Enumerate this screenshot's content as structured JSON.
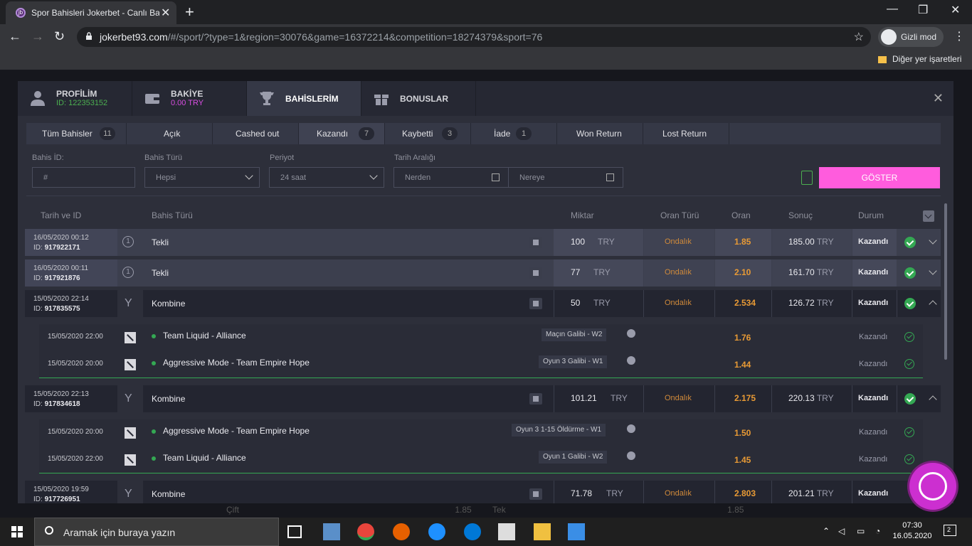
{
  "browser": {
    "tab_title": "Spor Bahisleri Jokerbet - Canlı Ba",
    "tab_favicon": "jb",
    "url_domain": "jokerbet93.com",
    "url_path": "/#/sport/?type=1&region=30076&game=16372214&competition=18274379&sport=76",
    "incognito_label": "Gizli mod",
    "bookmarks_label": "Diğer yer işaretleri"
  },
  "modal": {
    "tabs": [
      {
        "title": "PROFİLİM",
        "sub": "ID: 122353152",
        "icon": "user-icon",
        "color": "#4caf50"
      },
      {
        "title": "BAKİYE",
        "sub": "0.00 TRY",
        "icon": "wallet-icon",
        "color": "#d64de0"
      },
      {
        "title": "BAHİSLERİM",
        "sub": "",
        "icon": "trophy-icon",
        "color": ""
      },
      {
        "title": "BONUSLAR",
        "sub": "",
        "icon": "gift-icon",
        "color": ""
      }
    ],
    "filter_tabs": [
      {
        "label": "Tüm Bahisler",
        "count": "11"
      },
      {
        "label": "Açık",
        "count": ""
      },
      {
        "label": "Cashed out",
        "count": ""
      },
      {
        "label": "Kazandı",
        "count": "7"
      },
      {
        "label": "Kaybetti",
        "count": "3"
      },
      {
        "label": "İade",
        "count": "1"
      },
      {
        "label": "Won Return",
        "count": ""
      },
      {
        "label": "Lost Return",
        "count": ""
      }
    ],
    "form": {
      "bet_id_label": "Bahis İD:",
      "bet_id_placeholder": "#",
      "bet_type_label": "Bahis Türü",
      "bet_type_value": "Hepsi",
      "period_label": "Periyot",
      "period_value": "24 saat",
      "date_range_label": "Tarih Aralığı",
      "from_placeholder": "Nerden",
      "to_placeholder": "Nereye",
      "show_button": "GÖSTER"
    },
    "table_headers": {
      "date_id": "Tarih ve ID",
      "bet_type": "Bahis Türü",
      "amount": "Miktar",
      "odds_type": "Oran Türü",
      "odds": "Oran",
      "result": "Sonuç",
      "status": "Durum"
    },
    "bets": [
      {
        "date": "16/05/2020 00:12",
        "id_label": "ID:",
        "id": "917922171",
        "kind_icon": "1",
        "type": "Tekli",
        "amount": "100",
        "currency": "TRY",
        "odds_type": "Ondalık",
        "odds": "1.85",
        "result": "185.00",
        "result_cur": "TRY",
        "status": "Kazandı"
      },
      {
        "date": "16/05/2020 00:11",
        "id_label": "ID:",
        "id": "917921876",
        "kind_icon": "1",
        "type": "Tekli",
        "amount": "77",
        "currency": "TRY",
        "odds_type": "Ondalık",
        "odds": "2.10",
        "result": "161.70",
        "result_cur": "TRY",
        "status": "Kazandı"
      },
      {
        "date": "15/05/2020 22:14",
        "id_label": "ID:",
        "id": "917835575",
        "kind_icon": "Y",
        "type": "Kombine",
        "amount": "50",
        "currency": "TRY",
        "odds_type": "Ondalık",
        "odds": "2.534",
        "result": "126.72",
        "result_cur": "TRY",
        "status": "Kazandı"
      },
      {
        "date": "15/05/2020 22:13",
        "id_label": "ID:",
        "id": "917834618",
        "kind_icon": "Y",
        "type": "Kombine",
        "amount": "101.21",
        "currency": "TRY",
        "odds_type": "Ondalık",
        "odds": "2.175",
        "result": "220.13",
        "result_cur": "TRY",
        "status": "Kazandı"
      },
      {
        "date": "15/05/2020 19:59",
        "id_label": "ID:",
        "id": "917726951",
        "kind_icon": "Y",
        "type": "Kombine",
        "amount": "71.78",
        "currency": "TRY",
        "odds_type": "Ondalık",
        "odds": "2.803",
        "result": "201.21",
        "result_cur": "TRY",
        "status": "Kazandı"
      }
    ],
    "selections": [
      {
        "date": "15/05/2020 22:00",
        "event": "Team Liquid - Alliance",
        "market": "Maçın Galibi - W2",
        "odds": "1.76",
        "status": "Kazandı"
      },
      {
        "date": "15/05/2020 20:00",
        "event": "Aggressive Mode - Team Empire Hope",
        "market": "Oyun 3 Galibi - W1",
        "odds": "1.44",
        "status": "Kazandı"
      },
      {
        "date": "15/05/2020 20:00",
        "event": "Aggressive Mode - Team Empire Hope",
        "market": "Oyun 3 1-15 Öldürme - W1",
        "odds": "1.50",
        "status": "Kazandı"
      },
      {
        "date": "15/05/2020 22:00",
        "event": "Team Liquid - Alliance",
        "market": "Oyun 1 Galibi - W2",
        "odds": "1.45",
        "status": "Kazandı"
      }
    ]
  },
  "background": {
    "row_text": "Çift",
    "row_odds": "1.85",
    "row_text2": "Tek",
    "row_odds2": "1.85"
  },
  "taskbar": {
    "search_placeholder": "Aramak için buraya yazın",
    "time": "07:30",
    "date": "16.05.2020",
    "notifications": "2"
  },
  "colors": {
    "accent": "#ff5cdd",
    "win": "#34a853",
    "odds": "#e89a35"
  }
}
